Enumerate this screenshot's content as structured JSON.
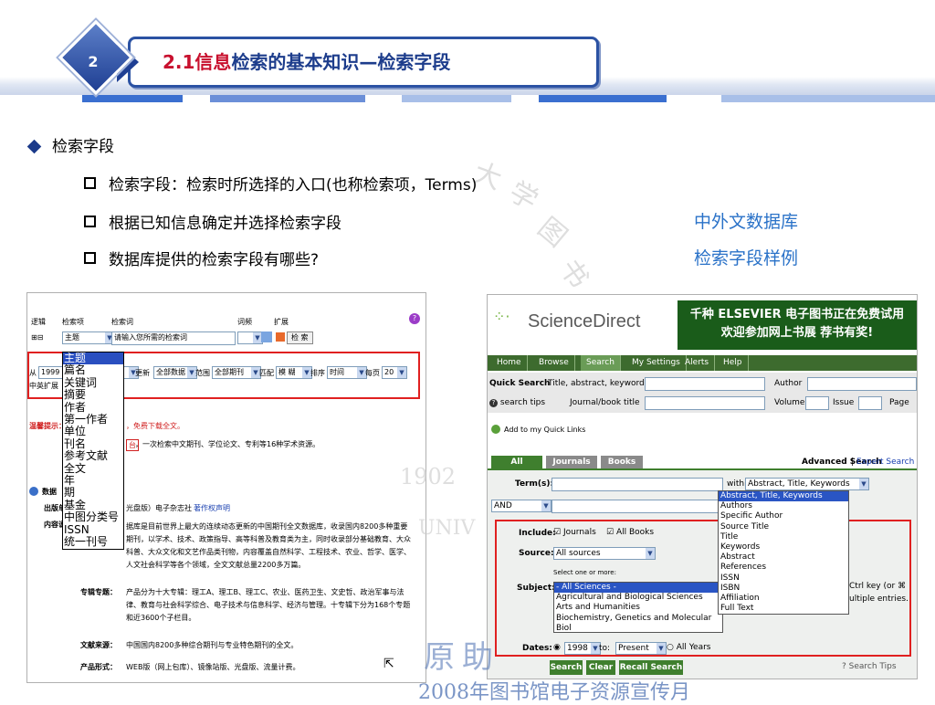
{
  "header": {
    "slide_number": "2",
    "title_red": "2.1信息",
    "title_blue": "检索的基本知识—检索字段",
    "stripe_colors": [
      "#3a6fd0",
      "#ffffff",
      "#6b8fd8",
      "#ffffff",
      "#a8bfe8",
      "#ffffff",
      "#3a6fd0",
      "#ffffff",
      "#a8bfe8"
    ]
  },
  "bullets": {
    "main": "检索字段",
    "items": [
      "检索字段：检索时所选择的入口(也称检索项，Terms)",
      "根据已知信息确定并选择检索字段",
      "数据库提供的检索字段有哪些?"
    ],
    "links": [
      "中外文数据库",
      "检索字段样例"
    ]
  },
  "watermark": {
    "chars": [
      "大",
      "学",
      "图",
      "书",
      "1902",
      "UNIV",
      "原",
      "助"
    ],
    "footer": "2008年图书馆电子资源宣传月"
  },
  "left_shot": {
    "cols": [
      "逻辑",
      "检索项",
      "检索词",
      "词频",
      "扩展"
    ],
    "row1": {
      "logic": "⊞⊟",
      "field": "主题",
      "term_placeholder": "请输入您所需的检索词",
      "search_btn": "检 索"
    },
    "row2": {
      "from_label": "从",
      "from_year": "1999",
      "update_label": "更新",
      "update_value": "全部数据",
      "range_label": "范围",
      "range_value": "全部期刊",
      "match_label": "匹配",
      "match_value": "模 糊",
      "sort_label": "排序",
      "sort_value": "时间",
      "perpage_label": "每页",
      "perpage_value": "20"
    },
    "row3_label": "中英扩展",
    "dropdown": [
      "主题",
      "篇名",
      "关键词",
      "摘要",
      "作者",
      "第一作者",
      "单位",
      "刊名",
      "参考文献",
      "全文",
      "年",
      "期",
      "基金",
      "中图分类号",
      "ISSN",
      "统一刊号"
    ],
    "notice": {
      "label": "温馨提示：",
      "line1": "，免费下载全文。",
      "line2_btn": "台",
      "line2": "，一次检索中文期刊、学位论文、专利等16种学术资源。"
    },
    "db_title": "数据",
    "unit_label": "出版单",
    "content_label": "内容说",
    "journal_line": "光盘版）电子杂志社",
    "journal_link": "著作权声明",
    "desc": [
      "据库是目前世界上最大的连续动态更新的中国期刊全文数据库，收录国内8200多种重要",
      "期刊，以学术、技术、政策指导、高等科普及教育类为主，同时收录部分基础教育、大众",
      "科普、大众文化和文艺作品类刊物，内容覆盖自然科学、工程技术、农业、哲学、医学、",
      "人文社会科学等各个领域，全文文献总量2200多万篇。"
    ],
    "special_label": "专辑专题：",
    "special_text": [
      "产品分为十大专辑：理工A、理工B、理工C、农业、医药卫生、文史哲、政治军事与法",
      "律、教育与社会科学综合、电子技术与信息科学、经济与管理。十专辑下分为168个专题",
      "和近3600个子栏目。"
    ],
    "source_label": "文献来源：",
    "source_text": "中国国内8200多种综合期刊与专业特色期刊的全文。",
    "form_label": "产品形式：",
    "form_text": "WEB版（网上包库）、镜像站版、光盘版、流量计费。"
  },
  "right_shot": {
    "logo": "ScienceDirect",
    "banner_line1": "千种 ELSEVIER 电子图书正在免费试用",
    "banner_line2": "欢迎参加网上书展 荐书有奖!",
    "nav": [
      "Home",
      "Browse",
      "Search",
      "My Settings",
      "Alerts",
      "Help"
    ],
    "quick_search_label": "Quick Search",
    "quick_search_hint": "Title, abstract, keywords",
    "author_label": "Author",
    "search_tips": "search tips",
    "journal_title_label": "Journal/book title",
    "volume_label": "Volume",
    "issue_label": "Issue",
    "page_label": "Page",
    "quick_links": "Add to my Quick Links",
    "source_tabs": [
      "All Sources",
      "Journals",
      "Books"
    ],
    "advanced": "Advanced Search",
    "expert": "Expert Search",
    "terms_label": "Term(s):",
    "within_label": "within:",
    "within_value": "Abstract, Title, Keywords",
    "operator": "AND",
    "within_options": [
      "Abstract, Title, Keywords",
      "Authors",
      "Specific Author",
      "Source Title",
      "Title",
      "Keywords",
      "Abstract",
      "References",
      "ISSN",
      "ISBN",
      "Affiliation",
      "Full Text"
    ],
    "include_label": "Include:",
    "include_journals": "Journals",
    "include_books": "All Books",
    "source_label": "Source:",
    "source_value": "All sources",
    "select_hint": "Select one or more:",
    "subject_label": "Subject:",
    "subjects": [
      "- All Sciences -",
      "Agricultural and Biological Sciences",
      "Arts and Humanities",
      "Biochemistry, Genetics and Molecular Biol"
    ],
    "ctrl_hint1": "Ctrl key (or ⌘",
    "ctrl_hint2": "ultiple entries.",
    "dates_label": "Dates:",
    "date_from": "1998",
    "to_label": "to:",
    "date_to": "Present",
    "all_years": "All Years",
    "buttons": [
      "Search",
      "Clear",
      "Recall Search"
    ],
    "search_tips_bottom": "Search Tips"
  }
}
